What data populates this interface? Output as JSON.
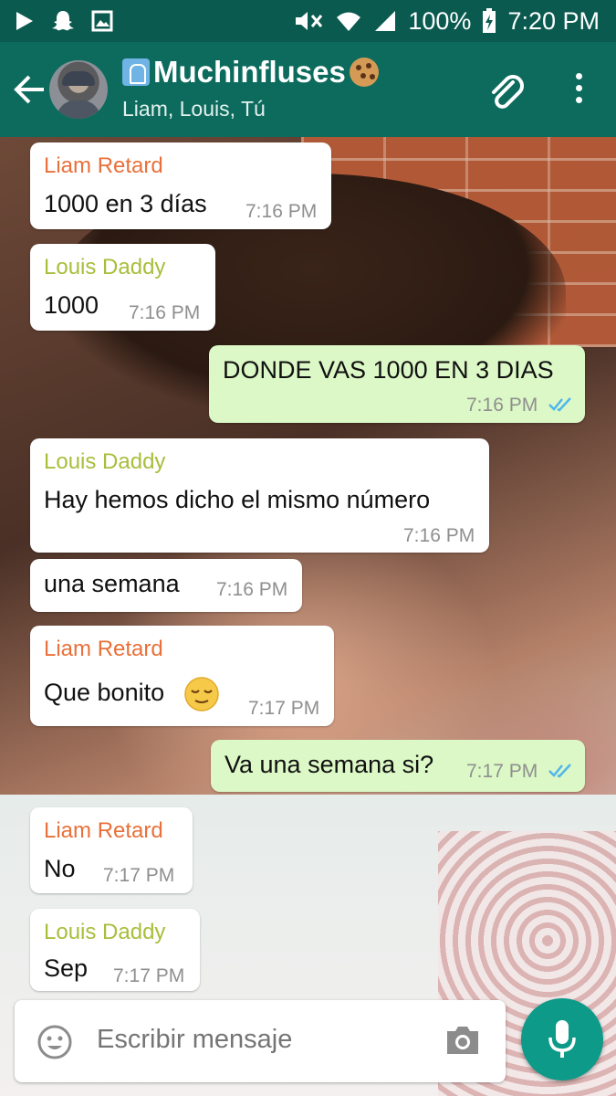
{
  "status_bar": {
    "battery": "100%",
    "time": "7:20 PM",
    "icons": [
      "play-icon",
      "snapchat-icon",
      "image-icon",
      "mute-icon",
      "wifi-icon",
      "signal-icon",
      "battery-charging-icon"
    ]
  },
  "header": {
    "title": "Muchinfluses",
    "title_emojis": [
      "carousel-horse-emoji",
      "cookie-emoji"
    ],
    "subtitle": "Liam, Louis, Tú"
  },
  "colors": {
    "header": "#0c6b5d",
    "status_bar": "#0a5a4f",
    "outgoing_bubble": "#dcf8c6",
    "incoming_bubble": "#ffffff",
    "liam_name": "#e8703a",
    "louis_name": "#a8be3b",
    "read_ticks": "#4fb6ec",
    "mic_button": "#0d9a89"
  },
  "messages": [
    {
      "sender": "Liam Retard",
      "text": "1000 en 3 días",
      "time": "7:16 PM"
    },
    {
      "sender": "Louis Daddy",
      "text": "1000",
      "time": "7:16 PM"
    },
    {
      "sender": "",
      "text": "DONDE VAS 1000 EN 3 DIAS",
      "time": "7:16 PM",
      "outgoing": true
    },
    {
      "sender": "Louis Daddy",
      "text": "Hay hemos dicho el mismo número",
      "time": "7:16 PM"
    },
    {
      "sender": "",
      "text": "una semana",
      "time": "7:16 PM"
    },
    {
      "sender": "Liam Retard",
      "text": "Que bonito",
      "time": "7:17 PM",
      "emoji": "relieved-face-emoji"
    },
    {
      "sender": "",
      "text": "Va una semana si?",
      "time": "7:17 PM",
      "outgoing": true
    },
    {
      "sender": "Liam Retard",
      "text": "No",
      "time": "7:17 PM"
    },
    {
      "sender": "Louis Daddy",
      "text": "Sep",
      "time": "7:17 PM"
    }
  ],
  "composer": {
    "placeholder": "Escribir mensaje"
  }
}
